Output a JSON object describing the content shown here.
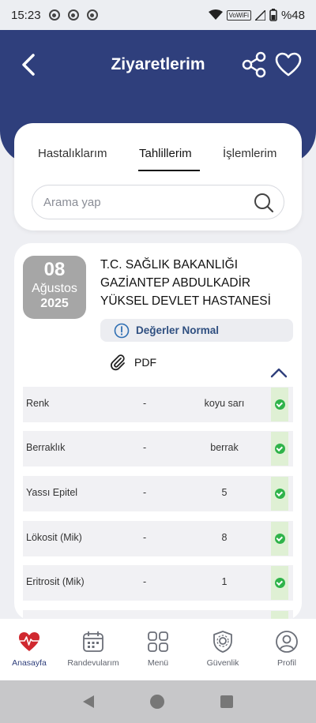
{
  "status_bar": {
    "time": "15:23",
    "network_label": "VoWiFi",
    "battery": "%48"
  },
  "header": {
    "title": "Ziyaretlerim"
  },
  "tabs": [
    {
      "label": "Hastalıklarım"
    },
    {
      "label": "Tahlillerim",
      "active": true
    },
    {
      "label": "İşlemlerim"
    }
  ],
  "search": {
    "placeholder": "Arama yap",
    "value": ""
  },
  "visit": {
    "date": {
      "day": "08",
      "month": "Ağustos",
      "year": "2025"
    },
    "hospital_lines": [
      "T.C. SAĞLIK BAKANLIĞI",
      "GAZİANTEP ABDULKADİR",
      "YÜKSEL DEVLET HASTANESİ"
    ],
    "status_text": "Değerler Normal",
    "pdf_label": "PDF",
    "results": [
      {
        "name": "Renk",
        "reference": "-",
        "value": "koyu sarı",
        "normal": true
      },
      {
        "name": "Berraklık",
        "reference": "-",
        "value": "berrak",
        "normal": true
      },
      {
        "name": "Yassı Epitel",
        "reference": "-",
        "value": "5",
        "normal": true
      },
      {
        "name": "Lökosit (Mik)",
        "reference": "-",
        "value": "8",
        "normal": true
      },
      {
        "name": "Eritrosit (Mik)",
        "reference": "-",
        "value": "1",
        "normal": true
      }
    ]
  },
  "bottom_nav": [
    {
      "label": "Anasayfa",
      "icon": "heart-home-icon",
      "active": true
    },
    {
      "label": "Randevularım",
      "icon": "calendar-icon"
    },
    {
      "label": "Menü",
      "icon": "grid-icon"
    },
    {
      "label": "Güvenlik",
      "icon": "shield-gear-icon"
    },
    {
      "label": "Profil",
      "icon": "user-icon"
    }
  ],
  "colors": {
    "header": "#2f3f7c",
    "status_text": "#2f4f80",
    "check": "#2fb34a",
    "date_box": "#a6a6a6"
  }
}
